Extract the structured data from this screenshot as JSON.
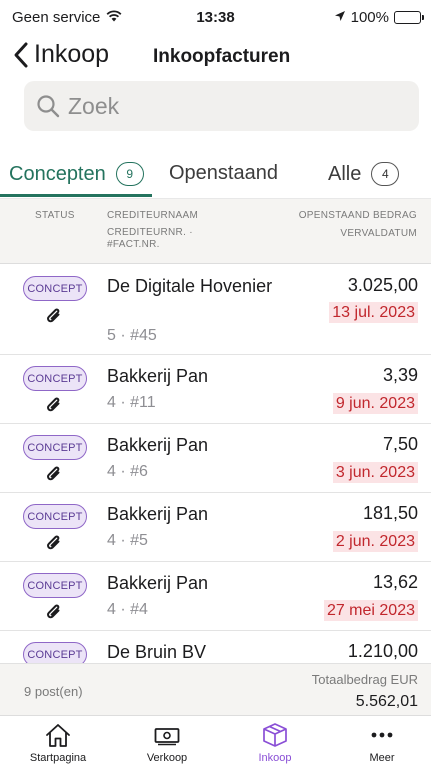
{
  "status_bar": {
    "carrier": "Geen service",
    "time": "13:38",
    "battery": "100%"
  },
  "nav": {
    "back_label": "Inkoop",
    "title": "Inkoopfacturen"
  },
  "search": {
    "placeholder": "Zoek"
  },
  "tabs": [
    {
      "label": "Concepten",
      "count": "9"
    },
    {
      "label": "Openstaand"
    },
    {
      "label": "Alle",
      "count": "4"
    }
  ],
  "columns": {
    "status": "STATUS",
    "name": "CREDITEURNAAM",
    "sub": "CREDITEURNR. · #FACT.NR.",
    "amount": "OPENSTAAND BEDRAG",
    "date": "VERVALDATUM"
  },
  "rows": [
    {
      "status": "CONCEPT",
      "name": "De Digitale Hovenier",
      "sub": "5 · #45",
      "amount": "3.025,00",
      "date": "13 jul. 2023",
      "attachment": true
    },
    {
      "status": "CONCEPT",
      "name": "Bakkerij Pan",
      "sub": "4 · #11",
      "amount": "3,39",
      "date": "9 jun. 2023",
      "attachment": true
    },
    {
      "status": "CONCEPT",
      "name": "Bakkerij Pan",
      "sub": "4 · #6",
      "amount": "7,50",
      "date": "3 jun. 2023",
      "attachment": true
    },
    {
      "status": "CONCEPT",
      "name": "Bakkerij Pan",
      "sub": "4 · #5",
      "amount": "181,50",
      "date": "2 jun. 2023",
      "attachment": true
    },
    {
      "status": "CONCEPT",
      "name": "Bakkerij Pan",
      "sub": "4 · #4",
      "amount": "13,62",
      "date": "27 mei 2023",
      "attachment": true
    },
    {
      "status": "CONCEPT",
      "name": "De Bruin BV",
      "sub": "",
      "amount": "1.210,00",
      "date": "",
      "attachment": false
    }
  ],
  "footer": {
    "posts": "9 post(en)",
    "total_label": "Totaalbedrag EUR",
    "total_value": "5.562,01"
  },
  "tabbar": [
    {
      "label": "Startpagina",
      "icon": "home-icon"
    },
    {
      "label": "Verkoop",
      "icon": "banknote-icon"
    },
    {
      "label": "Inkoop",
      "icon": "box-icon",
      "active": true
    },
    {
      "label": "Meer",
      "icon": "more-icon"
    }
  ],
  "colors": {
    "accent_green": "#24735e",
    "accent_purple": "#8a4fd6",
    "overdue_red": "#c1272d"
  }
}
